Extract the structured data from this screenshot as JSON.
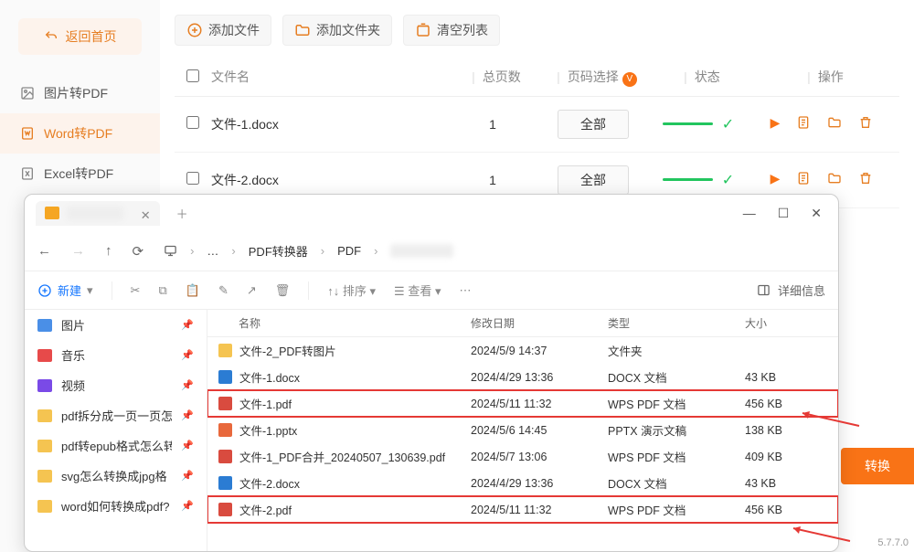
{
  "sidebar": {
    "back_label": "返回首页",
    "items": [
      {
        "label": "图片转PDF"
      },
      {
        "label": "Word转PDF"
      },
      {
        "label": "Excel转PDF"
      }
    ]
  },
  "toolbar": {
    "add_file": "添加文件",
    "add_folder": "添加文件夹",
    "clear_list": "清空列表"
  },
  "table": {
    "headers": {
      "name": "文件名",
      "pages": "总页数",
      "range": "页码选择",
      "status": "状态",
      "ops": "操作"
    },
    "rows": [
      {
        "name": "文件-1.docx",
        "pages": "1",
        "range": "全部"
      },
      {
        "name": "文件-2.docx",
        "pages": "1",
        "range": "全部"
      }
    ]
  },
  "explorer": {
    "tab_title": "",
    "crumbs": [
      "PDF转换器",
      "PDF"
    ],
    "new_btn": "新建",
    "sort": "排序",
    "view": "查看",
    "details": "详细信息",
    "side_items": [
      {
        "label": "图片",
        "icon": "blue"
      },
      {
        "label": "音乐",
        "icon": "red"
      },
      {
        "label": "视频",
        "icon": "purple"
      },
      {
        "label": "pdf拆分成一页一页怎",
        "icon": "folder"
      },
      {
        "label": "pdf转epub格式怎么转",
        "icon": "folder"
      },
      {
        "label": "svg怎么转换成jpg格",
        "icon": "folder"
      },
      {
        "label": "word如何转换成pdf?",
        "icon": "folder"
      }
    ],
    "columns": {
      "name": "名称",
      "date": "修改日期",
      "type": "类型",
      "size": "大小"
    },
    "files": [
      {
        "name": "文件-2_PDF转图片",
        "date": "2024/5/9 14:37",
        "type": "文件夹",
        "size": "",
        "icon": "folder",
        "hl": false
      },
      {
        "name": "文件-1.docx",
        "date": "2024/4/29 13:36",
        "type": "DOCX 文档",
        "size": "43 KB",
        "icon": "docx",
        "hl": false
      },
      {
        "name": "文件-1.pdf",
        "date": "2024/5/11 11:32",
        "type": "WPS PDF 文档",
        "size": "456 KB",
        "icon": "pdf",
        "hl": true
      },
      {
        "name": "文件-1.pptx",
        "date": "2024/5/6 14:45",
        "type": "PPTX 演示文稿",
        "size": "138 KB",
        "icon": "pptx",
        "hl": false
      },
      {
        "name": "文件-1_PDF合并_20240507_130639.pdf",
        "date": "2024/5/7 13:06",
        "type": "WPS PDF 文档",
        "size": "409 KB",
        "icon": "pdf",
        "hl": false
      },
      {
        "name": "文件-2.docx",
        "date": "2024/4/29 13:36",
        "type": "DOCX 文档",
        "size": "43 KB",
        "icon": "docx",
        "hl": false
      },
      {
        "name": "文件-2.pdf",
        "date": "2024/5/11 11:32",
        "type": "WPS PDF 文档",
        "size": "456 KB",
        "icon": "pdf",
        "hl": true
      }
    ]
  },
  "convert_label": "转换",
  "version": "5.7.7.0"
}
